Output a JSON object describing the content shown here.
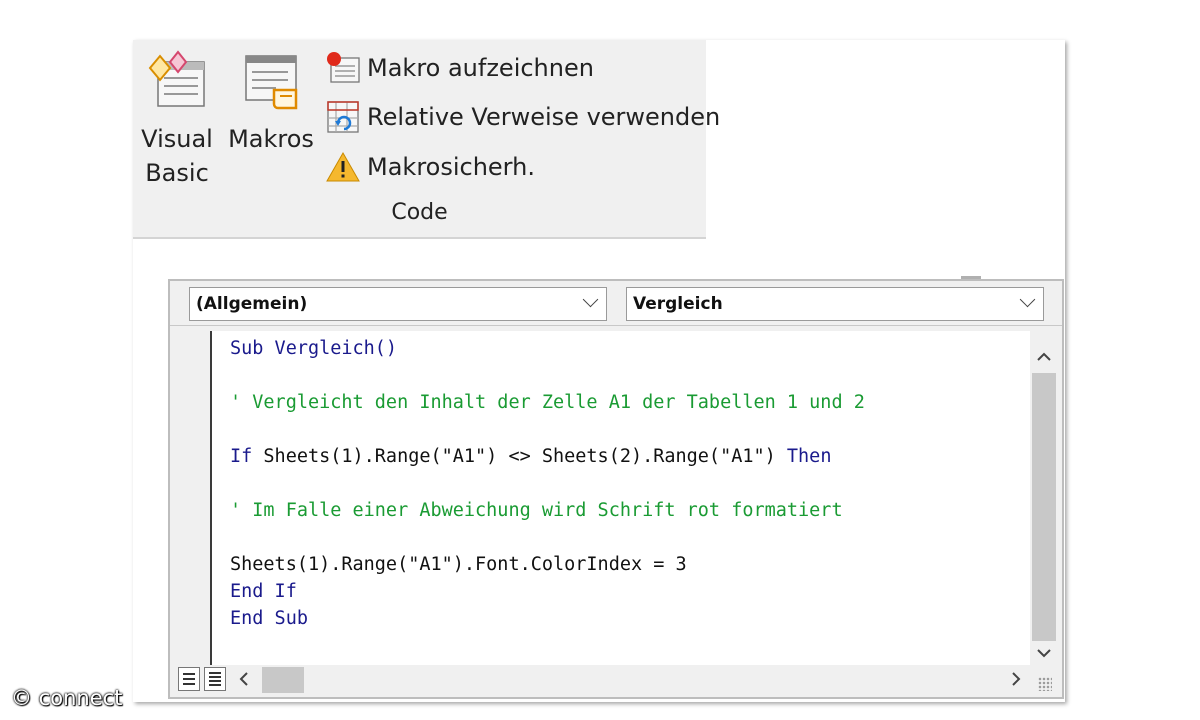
{
  "ribbon": {
    "visual_basic_label_line1": "Visual",
    "visual_basic_label_line2": "Basic",
    "macros_label": "Makros",
    "record_macro_label": "Makro aufzeichnen",
    "relative_refs_label": "Relative Verweise verwenden",
    "macro_security_label": "Makrosicherh.",
    "group_label": "Code"
  },
  "editor": {
    "object_combo_value": "(Allgemein)",
    "procedure_combo_value": "Vergleich",
    "code_lines": [
      {
        "kind": "kw",
        "text": "Sub Vergleich()"
      },
      {
        "kind": "cm",
        "text": "' Vergleicht den Inhalt der Zelle A1 der Tabellen 1 und 2"
      },
      {
        "kind": "mixed",
        "pre": "If",
        "mid": " Sheets(1).Range(\"A1\") <> Sheets(2).Range(\"A1\") ",
        "post": "Then"
      },
      {
        "kind": "cm",
        "text": "' Im Falle einer Abweichung wird Schrift rot formatiert"
      },
      {
        "kind": "tx",
        "text": "Sheets(1).Range(\"A1\").Font.ColorIndex = 3"
      },
      {
        "kind": "kw",
        "text": "End If"
      },
      {
        "kind": "kw",
        "text": "End Sub"
      }
    ]
  },
  "watermark": "© connect",
  "colors": {
    "keyword": "#1a1a8c",
    "comment": "#1a9b33",
    "ribbon_bg": "#f0f0f0"
  }
}
